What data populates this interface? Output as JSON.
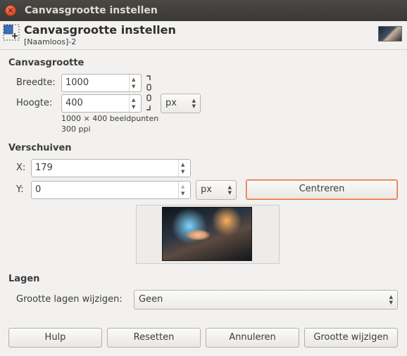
{
  "window": {
    "title": "Canvasgrootte instellen"
  },
  "header": {
    "title": "Canvasgrootte instellen",
    "subtitle": "[Naamloos]-2"
  },
  "canvas": {
    "heading": "Canvasgrootte",
    "width_label": "Breedte:",
    "width_value": "1000",
    "height_label": "Hoogte:",
    "height_value": "400",
    "unit": "px",
    "size_info": "1000 × 400 beeldpunten",
    "resolution_info": "300 ppi"
  },
  "offset": {
    "heading": "Verschuiven",
    "x_label": "X:",
    "x_value": "179",
    "y_label": "Y:",
    "y_value": "0",
    "unit": "px",
    "center_label": "Centreren"
  },
  "layers": {
    "heading": "Lagen",
    "resize_label": "Grootte lagen wijzigen:",
    "resize_value": "Geen"
  },
  "buttons": {
    "help": "Hulp",
    "reset": "Resetten",
    "cancel": "Annuleren",
    "resize": "Grootte wijzigen"
  },
  "colors": {
    "titlebar": "#3c3b37",
    "close": "#e0512c",
    "focus": "#e2733e"
  },
  "icons": {
    "close": "close-icon",
    "dialog": "canvas-size-icon",
    "chain": "chain-link-icon"
  }
}
